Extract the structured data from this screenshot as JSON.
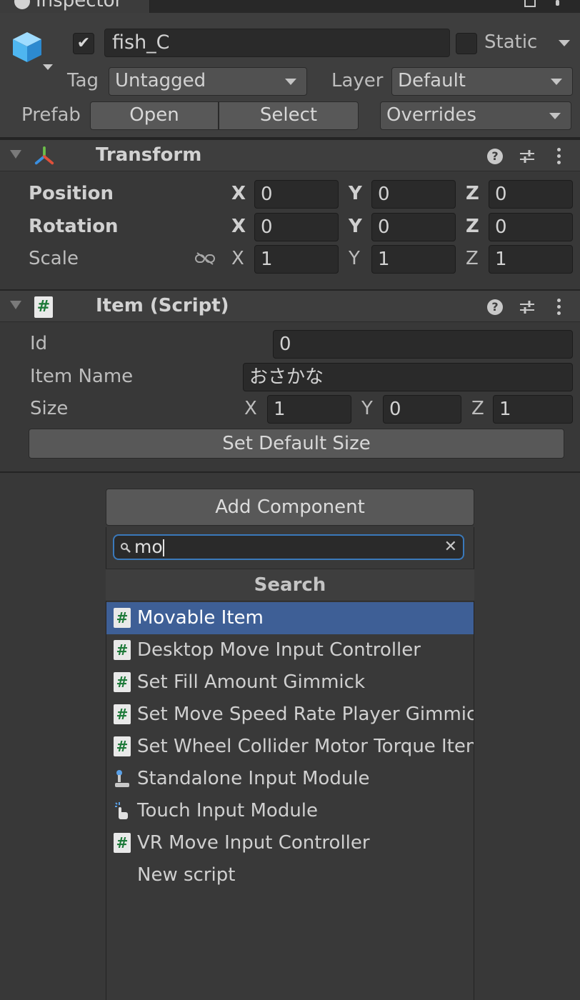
{
  "window": {
    "tab_title": "Inspector"
  },
  "header": {
    "object_name": "fish_C",
    "static_label": "Static",
    "tag_label": "Tag",
    "tag_value": "Untagged",
    "layer_label": "Layer",
    "layer_value": "Default",
    "prefab_label": "Prefab",
    "prefab_open": "Open",
    "prefab_select": "Select",
    "prefab_overrides": "Overrides"
  },
  "transform": {
    "title": "Transform",
    "rows": [
      {
        "label": "Position",
        "x": "0",
        "y": "0",
        "z": "0"
      },
      {
        "label": "Rotation",
        "x": "0",
        "y": "0",
        "z": "0"
      },
      {
        "label": "Scale",
        "x": "1",
        "y": "1",
        "z": "1"
      }
    ],
    "axis_x": "X",
    "axis_y": "Y",
    "axis_z": "Z"
  },
  "item_script": {
    "title": "Item (Script)",
    "id_label": "Id",
    "id_value": "0",
    "item_name_label": "Item Name",
    "item_name_value": "おさかな",
    "size_label": "Size",
    "size_x": "1",
    "size_y": "0",
    "size_z": "1",
    "set_default_button": "Set Default Size"
  },
  "add_component": {
    "button_label": "Add Component",
    "search_value": "mo",
    "section_title": "Search",
    "items": [
      {
        "label": "Movable Item",
        "icon": "script-icon",
        "selected": true
      },
      {
        "label": "Desktop Move Input Controller",
        "icon": "script-icon"
      },
      {
        "label": "Set Fill Amount Gimmick",
        "icon": "script-icon"
      },
      {
        "label": "Set Move Speed Rate Player Gimmick",
        "icon": "script-icon"
      },
      {
        "label": "Set Wheel Collider Motor Torque Item",
        "icon": "script-icon"
      },
      {
        "label": "Standalone Input Module",
        "icon": "standalone-input-icon"
      },
      {
        "label": "Touch Input Module",
        "icon": "touch-input-icon"
      },
      {
        "label": "VR Move Input Controller",
        "icon": "script-icon"
      },
      {
        "label": "New script",
        "icon": ""
      }
    ]
  },
  "colors": {
    "selected": "#3e5f96",
    "search_focus": "#3a79bb",
    "panel": "#383838"
  }
}
